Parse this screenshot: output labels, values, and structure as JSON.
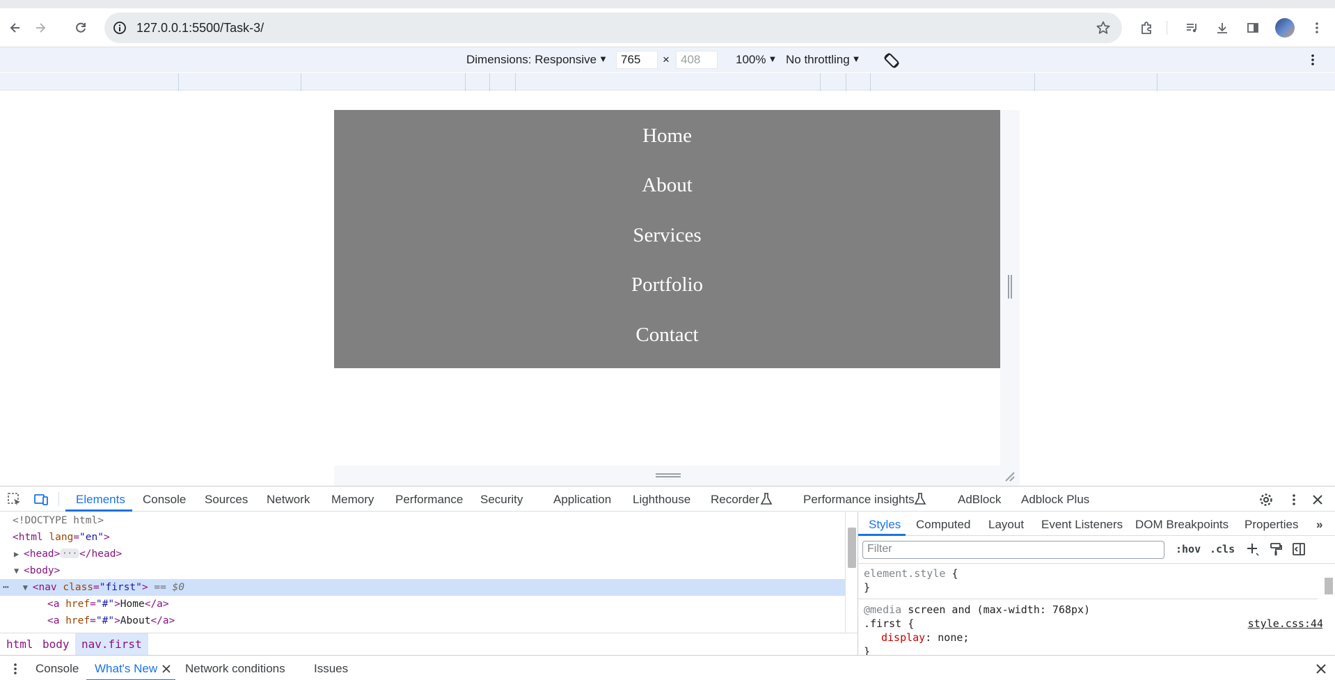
{
  "browser": {
    "url": "127.0.0.1:5500/Task-3/"
  },
  "device_toolbar": {
    "dimensions_label": "Dimensions: Responsive",
    "width": "765",
    "x_separator": "×",
    "height": "408",
    "zoom": "100%",
    "throttling": "No throttling"
  },
  "site_nav": {
    "links": [
      "Home",
      "About",
      "Services",
      "Portfolio",
      "Contact"
    ]
  },
  "devtools": {
    "tabs": [
      "Elements",
      "Console",
      "Sources",
      "Network",
      "Memory",
      "Performance",
      "Security",
      "Application",
      "Lighthouse",
      "Recorder",
      "Performance insights",
      "AdBlock",
      "Adblock Plus"
    ],
    "dom": {
      "doctype": "<!DOCTYPE html>",
      "html_tag": "html",
      "lang_attr": "lang",
      "lang_val": "\"en\"",
      "head_open": "<head>",
      "head_dots": "···",
      "head_close": "</head>",
      "body_tag": "<body>",
      "nav_tag_open": "<nav",
      "nav_attr": "class",
      "nav_val": "\"first\"",
      "nav_tag_end": ">",
      "nav_suffix": "== $0",
      "a_open": "<a",
      "a_attr": "href",
      "a_val": "\"#\"",
      "a_gt": ">",
      "a_close": "</a>",
      "link_home": "Home",
      "link_about": "About"
    },
    "breadcrumbs": [
      "html",
      "body",
      "nav.first"
    ],
    "styles": {
      "tabs": [
        "Styles",
        "Computed",
        "Layout",
        "Event Listeners",
        "DOM Breakpoints",
        "Properties"
      ],
      "filter_placeholder": "Filter",
      "hov": ":hov",
      "cls": ".cls",
      "element_style": "element.style",
      "open_brace": "{",
      "close_brace": "}",
      "media_keyword": "@media",
      "media_query": "screen and (max-width: 768px)",
      "selector": ".first",
      "source": "style.css:44",
      "property": "display",
      "value": "none;"
    },
    "drawer": {
      "tabs": [
        "Console",
        "What's New",
        "Network conditions",
        "Issues"
      ]
    }
  }
}
